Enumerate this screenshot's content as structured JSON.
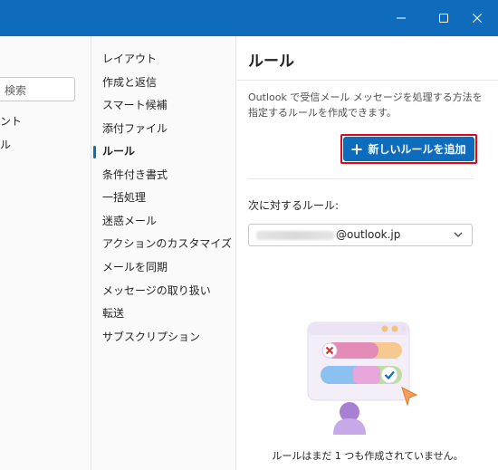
{
  "window": {
    "minimize_icon": "minimize-icon",
    "maximize_icon": "maximize-icon",
    "close_icon": "close-icon",
    "titlebar_color": "#0f6cbd"
  },
  "left_column": {
    "search_placeholder": "検索",
    "items": [
      "ント",
      "ル"
    ]
  },
  "nav": {
    "items": [
      {
        "label": "レイアウト",
        "active": false
      },
      {
        "label": "作成と返信",
        "active": false
      },
      {
        "label": "スマート候補",
        "active": false
      },
      {
        "label": "添付ファイル",
        "active": false
      },
      {
        "label": "ルール",
        "active": true
      },
      {
        "label": "条件付き書式",
        "active": false
      },
      {
        "label": "一括処理",
        "active": false
      },
      {
        "label": "迷惑メール",
        "active": false
      },
      {
        "label": "アクションのカスタマイズ",
        "active": false
      },
      {
        "label": "メールを同期",
        "active": false
      },
      {
        "label": "メッセージの取り扱い",
        "active": false
      },
      {
        "label": "転送",
        "active": false
      },
      {
        "label": "サブスクリプション",
        "active": false
      }
    ]
  },
  "panel": {
    "title": "ルール",
    "description": "Outlook で受信メール メッセージを処理する方法を指定するルールを作成できます。",
    "new_rule_label": "新しいルールを追加",
    "new_rule_icon": "plus-icon",
    "rules_for_label": "次に対するルール:",
    "account_domain": "@outlook.jp",
    "dropdown_icon": "chevron-down-icon",
    "empty_message": "ルールはまだ 1 つも作成されていません。",
    "accent_color": "#0f6cbd",
    "highlight_color": "#e0061f"
  }
}
